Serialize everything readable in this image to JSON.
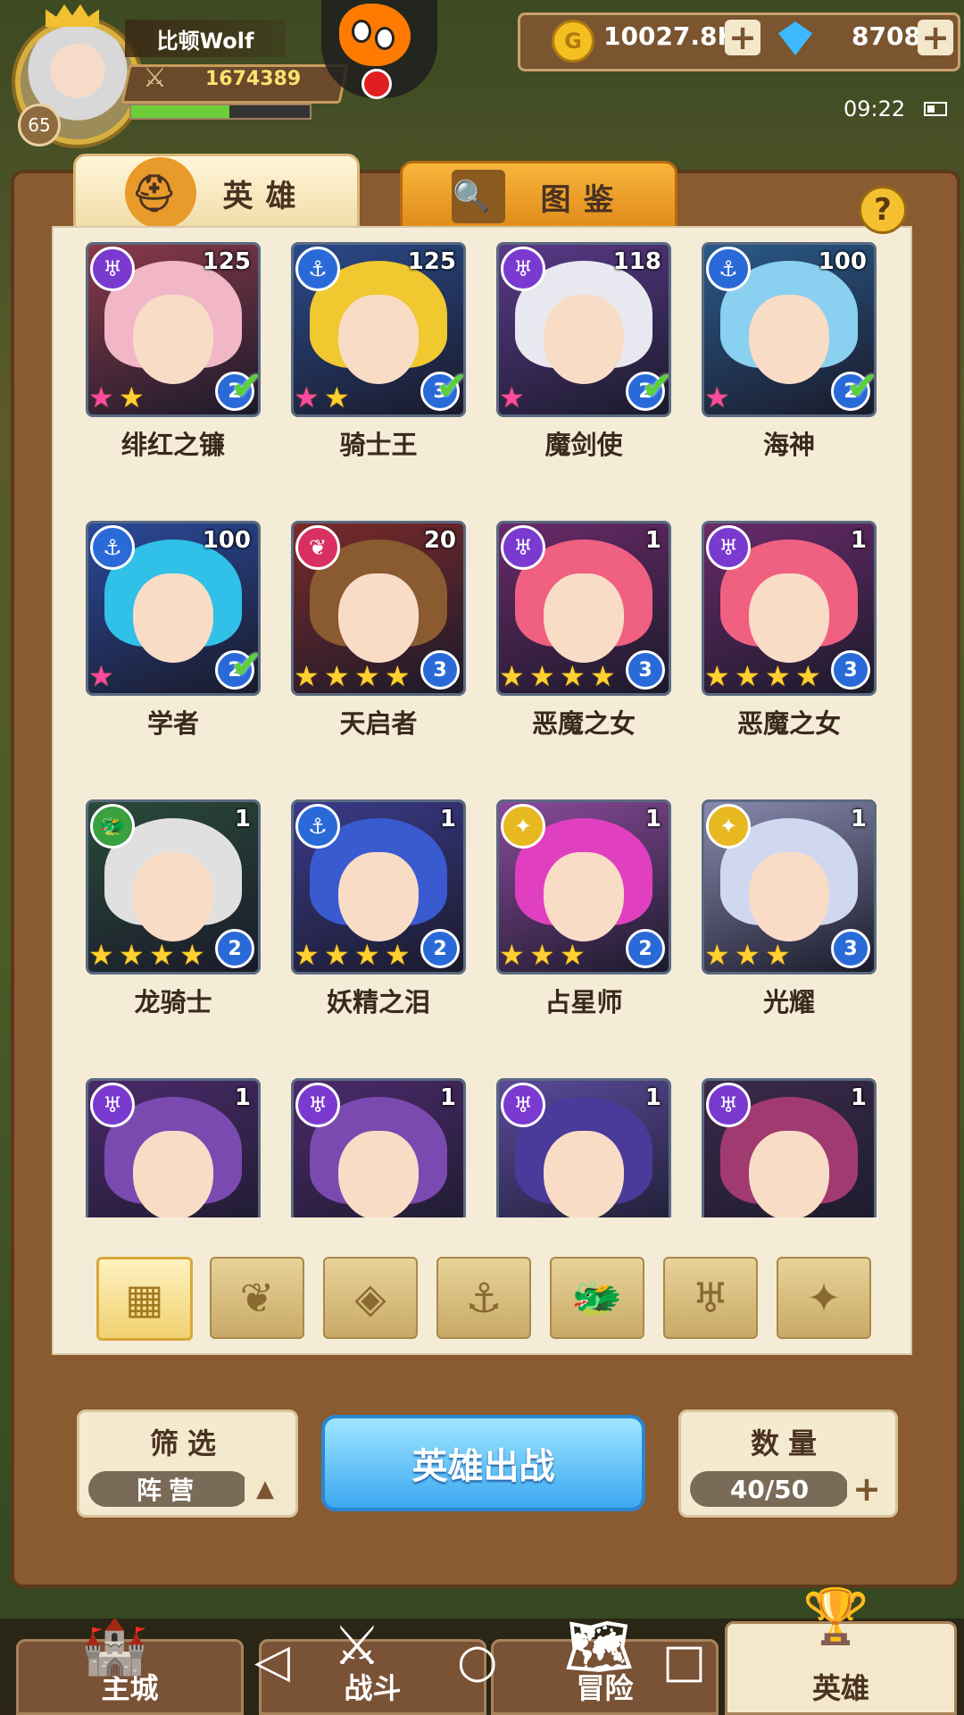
{
  "player": {
    "name": "比顿Wolf",
    "power": "1674389",
    "level": "65",
    "xp_fraction": 0.55
  },
  "resources": {
    "gold": "10027.8K",
    "gems": "8708"
  },
  "status": {
    "time": "09:22"
  },
  "tabs": [
    {
      "label": "英雄",
      "active": true
    },
    {
      "label": "图鉴",
      "active": false
    }
  ],
  "heroes": [
    {
      "name": "绯红之镰",
      "level": "125",
      "faction": "demon",
      "stars": 2,
      "rainbow": true,
      "stage": "2",
      "owned_check": true,
      "hair": "#f2b7c6",
      "bg": "#8a3a4a"
    },
    {
      "name": "骑士王",
      "level": "125",
      "faction": "sea",
      "stars": 2,
      "rainbow": true,
      "stage": "3",
      "owned_check": true,
      "hair": "#f0c830",
      "bg": "#2a4a8a"
    },
    {
      "name": "魔剑使",
      "level": "118",
      "faction": "demon",
      "stars": 1,
      "rainbow": true,
      "stage": "2",
      "owned_check": true,
      "hair": "#e8e8f0",
      "bg": "#5a3a8a"
    },
    {
      "name": "海神",
      "level": "100",
      "faction": "sea",
      "stars": 1,
      "rainbow": true,
      "stage": "2",
      "owned_check": true,
      "hair": "#8ad0f0",
      "bg": "#2a5a8a"
    },
    {
      "name": "学者",
      "level": "100",
      "faction": "sea",
      "stars": 1,
      "rainbow": true,
      "stage": "2",
      "owned_check": true,
      "hair": "#30c0e8",
      "bg": "#2a4a9a"
    },
    {
      "name": "天启者",
      "level": "20",
      "faction": "flame",
      "stars": 4,
      "rainbow": false,
      "stage": "3",
      "owned_check": false,
      "hair": "#8a5a30",
      "bg": "#7a2a2a"
    },
    {
      "name": "恶魔之女",
      "level": "1",
      "faction": "demon",
      "stars": 4,
      "rainbow": false,
      "stage": "3",
      "owned_check": false,
      "hair": "#f06080",
      "bg": "#6a2a6a"
    },
    {
      "name": "恶魔之女",
      "level": "1",
      "faction": "demon",
      "stars": 4,
      "rainbow": false,
      "stage": "3",
      "owned_check": false,
      "hair": "#f06080",
      "bg": "#6a2a6a"
    },
    {
      "name": "龙骑士",
      "level": "1",
      "faction": "beast",
      "stars": 4,
      "rainbow": false,
      "stage": "2",
      "owned_check": false,
      "hair": "#e0e0e0",
      "bg": "#2a4a3a"
    },
    {
      "name": "妖精之泪",
      "level": "1",
      "faction": "sea",
      "stars": 4,
      "rainbow": false,
      "stage": "2",
      "owned_check": false,
      "hair": "#3a5ad0",
      "bg": "#3a3a8a"
    },
    {
      "name": "占星师",
      "level": "1",
      "faction": "light",
      "stars": 3,
      "rainbow": false,
      "stage": "2",
      "owned_check": false,
      "hair": "#e040c0",
      "bg": "#8a4a9a"
    },
    {
      "name": "光耀",
      "level": "1",
      "faction": "light",
      "stars": 3,
      "rainbow": false,
      "stage": "3",
      "owned_check": false,
      "hair": "#d0d8f0",
      "bg": "#8a8ab0"
    },
    {
      "name": "",
      "level": "1",
      "faction": "demon",
      "stars": 0,
      "rainbow": false,
      "stage": "",
      "owned_check": false,
      "hair": "#7a4ab0",
      "bg": "#4a2a6a"
    },
    {
      "name": "",
      "level": "1",
      "faction": "demon",
      "stars": 0,
      "rainbow": false,
      "stage": "",
      "owned_check": false,
      "hair": "#7a4ab0",
      "bg": "#4a2a6a"
    },
    {
      "name": "",
      "level": "1",
      "faction": "demon",
      "stars": 0,
      "rainbow": false,
      "stage": "",
      "owned_check": false,
      "hair": "#4a3a9a",
      "bg": "#5a4a9a"
    },
    {
      "name": "",
      "level": "1",
      "faction": "demon",
      "stars": 0,
      "rainbow": false,
      "stage": "",
      "owned_check": false,
      "hair": "#a03a70",
      "bg": "#3a2a4a"
    }
  ],
  "faction_colors": {
    "demon": "#7a3ad0",
    "sea": "#2a6ad8",
    "flame": "#d83060",
    "beast": "#3aa040",
    "light": "#e8b820"
  },
  "faction_filters": [
    "all-grid-icon",
    "flame-icon",
    "nature-icon",
    "anchor-icon",
    "beast-icon",
    "demon-icon",
    "light-icon"
  ],
  "controls": {
    "filter_label": "筛选",
    "filter_value": "阵营",
    "deploy_label": "英雄出战",
    "count_label": "数量",
    "count_value": "40/50"
  },
  "nav": [
    {
      "label": "主城",
      "icon": "castle-icon",
      "active": false
    },
    {
      "label": "战斗",
      "icon": "crossed-swords-icon",
      "active": false
    },
    {
      "label": "冒险",
      "icon": "map-icon",
      "active": false
    },
    {
      "label": "英雄",
      "icon": "hero-helmet-icon",
      "active": true
    }
  ]
}
